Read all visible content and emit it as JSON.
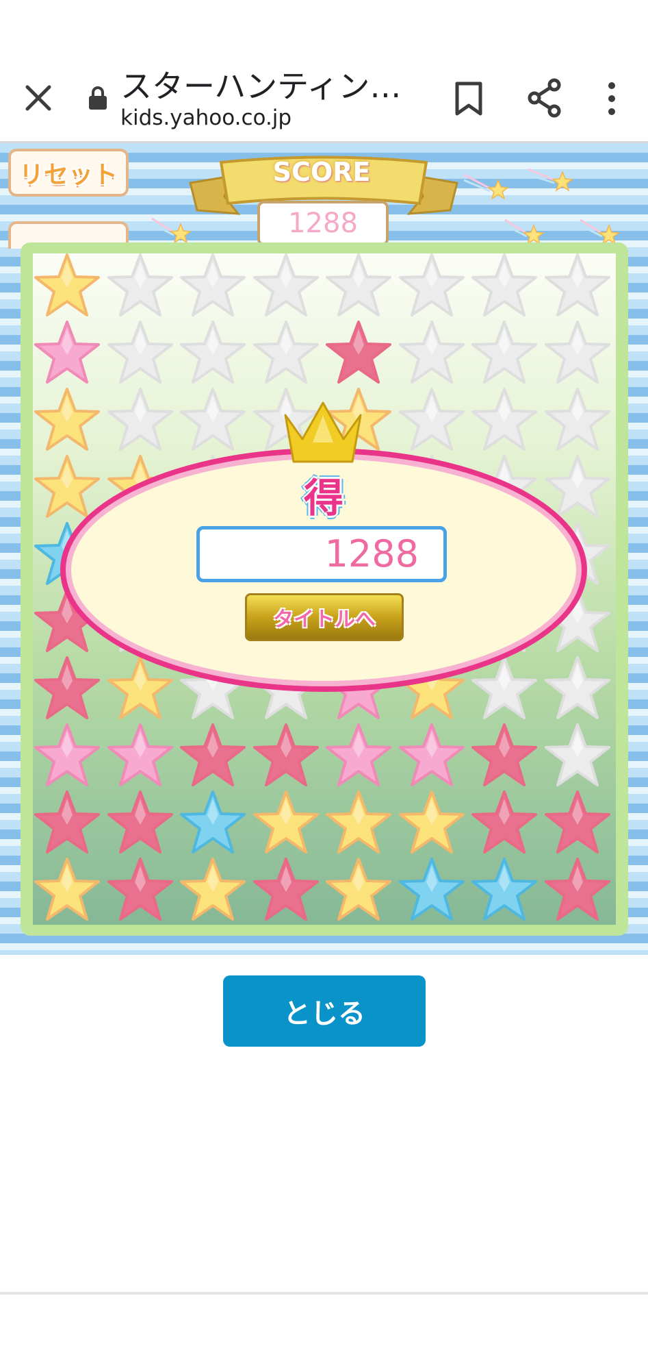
{
  "browser": {
    "title": "スターハンティン…",
    "url": "kids.yahoo.co.jp",
    "icons": [
      "close-icon",
      "lock-icon",
      "bookmark-icon",
      "share-icon",
      "more-icon"
    ]
  },
  "game": {
    "reset_label": "リセット",
    "score_label": "SCORE",
    "score_value": "1288",
    "board_rows": [
      [
        "yellow",
        "gray",
        "gray",
        "gray",
        "gray",
        "gray",
        "gray",
        "gray"
      ],
      [
        "pink",
        "gray",
        "gray",
        "gray",
        "rose",
        "gray",
        "gray",
        "gray"
      ],
      [
        "yellow",
        "gray",
        "gray",
        "gray",
        "yellow",
        "gray",
        "gray",
        "gray"
      ],
      [
        "yellow",
        "yellow",
        "gray",
        "gray",
        "gray",
        "gray",
        "gray",
        "gray"
      ],
      [
        "blue",
        "gray",
        "gray",
        "gray",
        "gray",
        "gray",
        "gray",
        "gray"
      ],
      [
        "rose",
        "gray",
        "gray",
        "gray",
        "gray",
        "gray",
        "gray",
        "gray"
      ],
      [
        "rose",
        "yellow",
        "gray",
        "gray",
        "pink",
        "yellow",
        "gray",
        "gray"
      ],
      [
        "pink",
        "pink",
        "rose",
        "rose",
        "pink",
        "pink",
        "rose",
        "gray"
      ],
      [
        "rose",
        "rose",
        "blue",
        "yellow",
        "yellow",
        "yellow",
        "rose",
        "rose"
      ],
      [
        "yellow",
        "rose",
        "yellow",
        "rose",
        "yellow",
        "blue",
        "blue",
        "rose"
      ]
    ],
    "star_colors": {
      "yellow": "#fbe27a",
      "pink": "#f7a9cf",
      "rose": "#e9708f",
      "blue": "#7fd3f0",
      "gray": "#ececec"
    }
  },
  "result": {
    "title": "得点",
    "score": "1288",
    "title_button": "タイトルへ"
  },
  "close_button": "とじる"
}
